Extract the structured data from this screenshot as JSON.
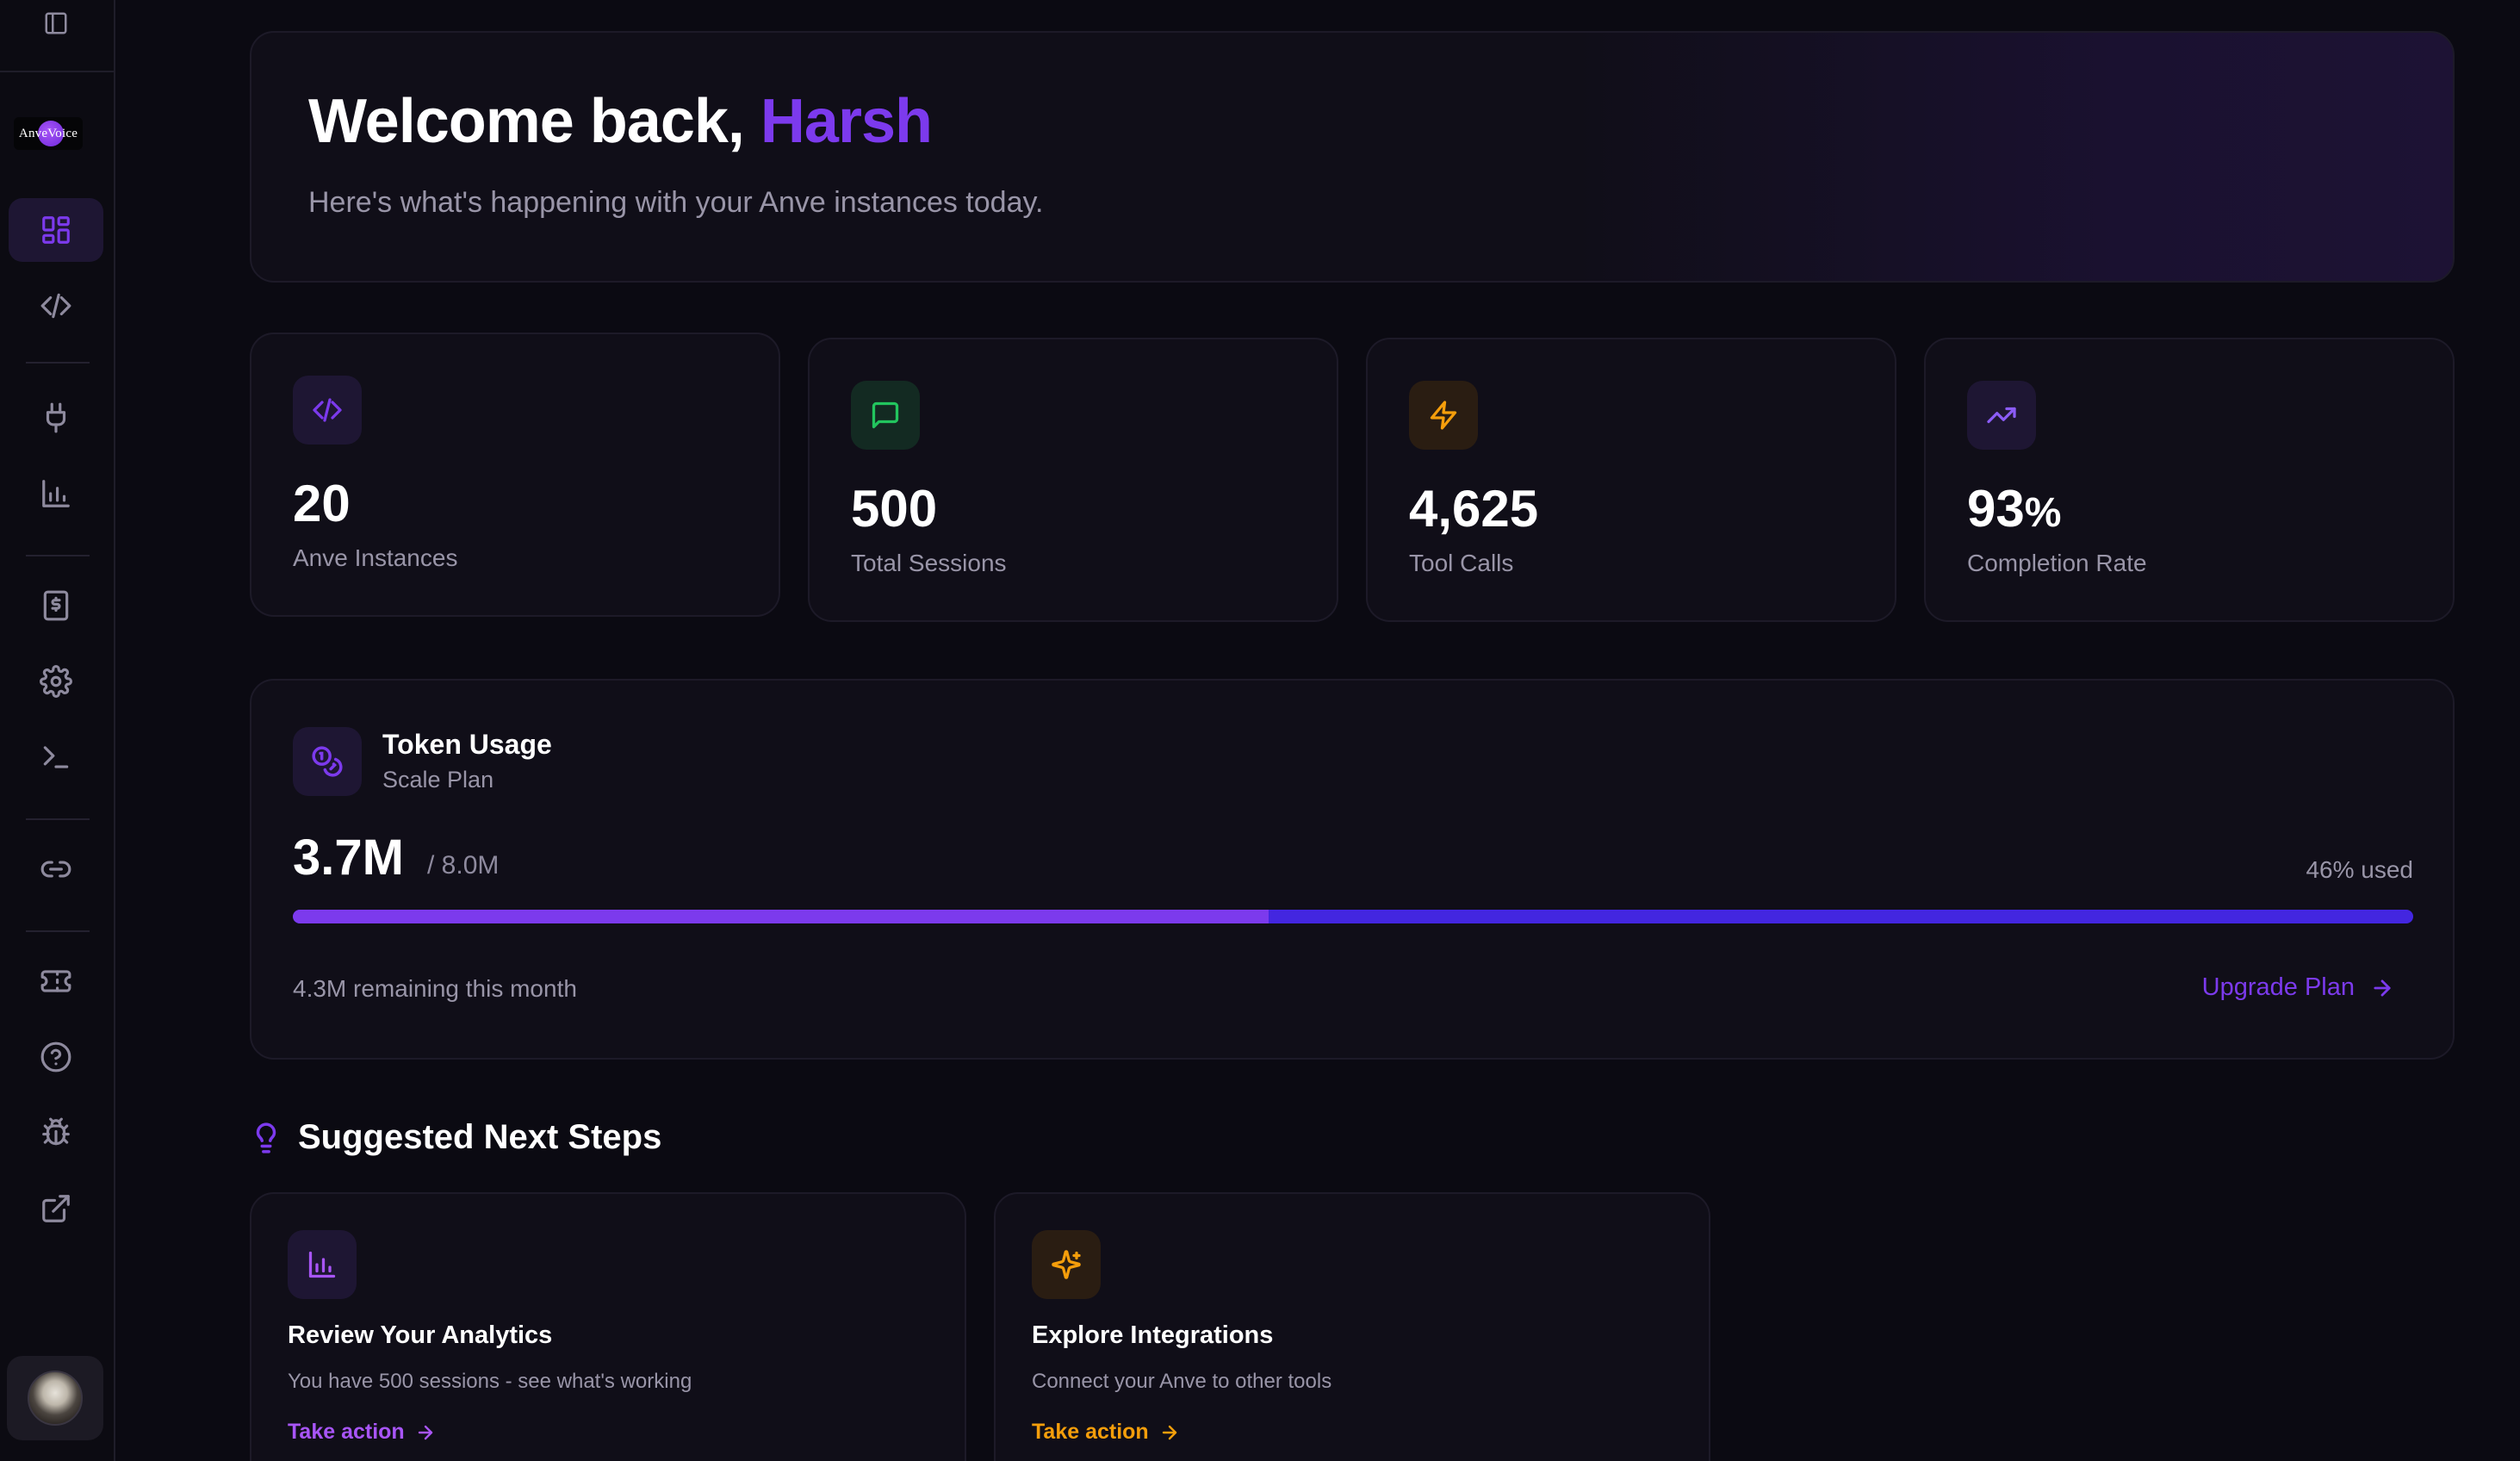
{
  "brand": {
    "logo_text": "AnveVoice"
  },
  "sidebar": {
    "items": [
      {
        "name": "dashboard",
        "icon": "layout-grid-icon",
        "active": true
      },
      {
        "name": "code",
        "icon": "code-icon"
      },
      {
        "name": "integrations",
        "icon": "plug-icon"
      },
      {
        "name": "analytics",
        "icon": "bar-chart-icon"
      },
      {
        "name": "billing",
        "icon": "receipt-dollar-icon"
      },
      {
        "name": "settings",
        "icon": "gear-icon"
      },
      {
        "name": "console",
        "icon": "terminal-icon"
      },
      {
        "name": "links",
        "icon": "link-icon"
      },
      {
        "name": "tickets",
        "icon": "ticket-icon"
      },
      {
        "name": "help",
        "icon": "help-circle-icon"
      },
      {
        "name": "bug-report",
        "icon": "bug-icon"
      },
      {
        "name": "external",
        "icon": "external-link-icon"
      }
    ]
  },
  "welcome": {
    "greeting": "Welcome back, ",
    "user_name": "Harsh",
    "subtitle": "Here's what's happening with your Anve instances today."
  },
  "stats": [
    {
      "value": "20",
      "unit": "",
      "label": "Anve Instances",
      "icon": "code-icon",
      "color": "#7c3aed"
    },
    {
      "value": "500",
      "unit": "",
      "label": "Total Sessions",
      "icon": "message-square-icon",
      "color": "#22c55e"
    },
    {
      "value": "4,625",
      "unit": "",
      "label": "Tool Calls",
      "icon": "zap-icon",
      "color": "#f59e0b"
    },
    {
      "value": "93",
      "unit": "%",
      "label": "Completion Rate",
      "icon": "trending-up-icon",
      "color": "#7c3aed"
    }
  ],
  "token_usage": {
    "title": "Token Usage",
    "plan": "Scale Plan",
    "used": "3.7M",
    "limit": "/ 8.0M",
    "percent_label": "46% used",
    "percent": 46,
    "remaining": "4.3M remaining this month",
    "upgrade_label": "Upgrade Plan"
  },
  "next_steps": {
    "heading": "Suggested Next Steps",
    "items": [
      {
        "title": "Review Your Analytics",
        "description": "You have 500 sessions - see what's working",
        "action": "Take action",
        "icon": "bar-chart-icon",
        "color": "#a855f7"
      },
      {
        "title": "Explore Integrations",
        "description": "Connect your Anve to other tools",
        "action": "Take action",
        "icon": "sparkles-icon",
        "color": "#f59e0b"
      }
    ]
  },
  "colors": {
    "accent": "#7c3aed",
    "bar_track": "#4326e0",
    "background": "#0b0a12",
    "card": "#100e18"
  }
}
